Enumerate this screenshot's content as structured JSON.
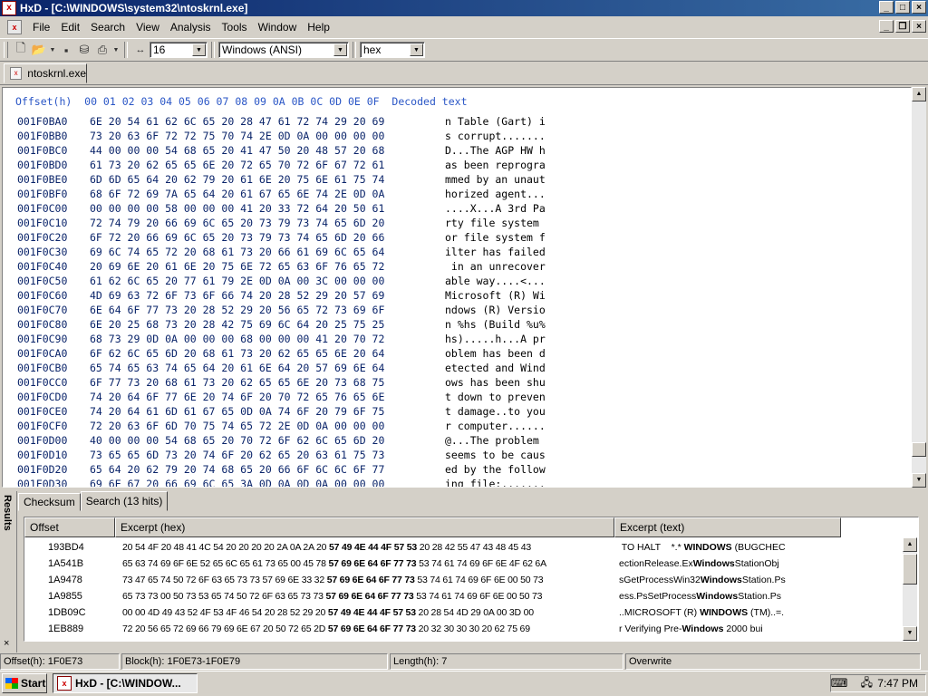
{
  "window": {
    "app_name": "HxD",
    "title": "HxD - [C:\\WINDOWS\\system32\\ntoskrnl.exe]"
  },
  "menu": [
    "File",
    "Edit",
    "Search",
    "View",
    "Analysis",
    "Tools",
    "Window",
    "Help"
  ],
  "toolbar": {
    "bytes_per_row": "16",
    "charset": "Windows (ANSI)",
    "display_mode": "hex"
  },
  "file_tab": {
    "label": "ntoskrnl.exe"
  },
  "hex_view": {
    "header": "Offset(h)  00 01 02 03 04 05 06 07 08 09 0A 0B 0C 0D 0E 0F  Decoded text",
    "rows": [
      {
        "offset": "001F0BA0",
        "bytes": "6E 20 54 61 62 6C 65 20 28 47 61 72 74 29 20 69",
        "text": "n Table (Gart) i"
      },
      {
        "offset": "001F0BB0",
        "bytes": "73 20 63 6F 72 72 75 70 74 2E 0D 0A 00 00 00 00",
        "text": "s corrupt......."
      },
      {
        "offset": "001F0BC0",
        "bytes": "44 00 00 00 54 68 65 20 41 47 50 20 48 57 20 68",
        "text": "D...The AGP HW h"
      },
      {
        "offset": "001F0BD0",
        "bytes": "61 73 20 62 65 65 6E 20 72 65 70 72 6F 67 72 61",
        "text": "as been reprogra"
      },
      {
        "offset": "001F0BE0",
        "bytes": "6D 6D 65 64 20 62 79 20 61 6E 20 75 6E 61 75 74",
        "text": "mmed by an unaut"
      },
      {
        "offset": "001F0BF0",
        "bytes": "68 6F 72 69 7A 65 64 20 61 67 65 6E 74 2E 0D 0A",
        "text": "horized agent..."
      },
      {
        "offset": "001F0C00",
        "bytes": "00 00 00 00 58 00 00 00 41 20 33 72 64 20 50 61",
        "text": "....X...A 3rd Pa"
      },
      {
        "offset": "001F0C10",
        "bytes": "72 74 79 20 66 69 6C 65 20 73 79 73 74 65 6D 20",
        "text": "rty file system "
      },
      {
        "offset": "001F0C20",
        "bytes": "6F 72 20 66 69 6C 65 20 73 79 73 74 65 6D 20 66",
        "text": "or file system f"
      },
      {
        "offset": "001F0C30",
        "bytes": "69 6C 74 65 72 20 68 61 73 20 66 61 69 6C 65 64",
        "text": "ilter has failed"
      },
      {
        "offset": "001F0C40",
        "bytes": "20 69 6E 20 61 6E 20 75 6E 72 65 63 6F 76 65 72",
        "text": " in an unrecover"
      },
      {
        "offset": "001F0C50",
        "bytes": "61 62 6C 65 20 77 61 79 2E 0D 0A 00 3C 00 00 00",
        "text": "able way....<..."
      },
      {
        "offset": "001F0C60",
        "bytes": "4D 69 63 72 6F 73 6F 66 74 20 28 52 29 20 57 69",
        "text": "Microsoft (R) Wi"
      },
      {
        "offset": "001F0C70",
        "bytes": "6E 64 6F 77 73 20 28 52 29 20 56 65 72 73 69 6F",
        "text": "ndows (R) Versio"
      },
      {
        "offset": "001F0C80",
        "bytes": "6E 20 25 68 73 20 28 42 75 69 6C 64 20 25 75 25",
        "text": "n %hs (Build %u%"
      },
      {
        "offset": "001F0C90",
        "bytes": "68 73 29 0D 0A 00 00 00 68 00 00 00 41 20 70 72",
        "text": "hs).....h...A pr"
      },
      {
        "offset": "001F0CA0",
        "bytes": "6F 62 6C 65 6D 20 68 61 73 20 62 65 65 6E 20 64",
        "text": "oblem has been d"
      },
      {
        "offset": "001F0CB0",
        "bytes": "65 74 65 63 74 65 64 20 61 6E 64 20 57 69 6E 64",
        "text": "etected and Wind"
      },
      {
        "offset": "001F0CC0",
        "bytes": "6F 77 73 20 68 61 73 20 62 65 65 6E 20 73 68 75",
        "text": "ows has been shu"
      },
      {
        "offset": "001F0CD0",
        "bytes": "74 20 64 6F 77 6E 20 74 6F 20 70 72 65 76 65 6E",
        "text": "t down to preven"
      },
      {
        "offset": "001F0CE0",
        "bytes": "74 20 64 61 6D 61 67 65 0D 0A 74 6F 20 79 6F 75",
        "text": "t damage..to you"
      },
      {
        "offset": "001F0CF0",
        "bytes": "72 20 63 6F 6D 70 75 74 65 72 2E 0D 0A 00 00 00",
        "text": "r computer......"
      },
      {
        "offset": "001F0D00",
        "bytes": "40 00 00 00 54 68 65 20 70 72 6F 62 6C 65 6D 20",
        "text": "@...The problem "
      },
      {
        "offset": "001F0D10",
        "bytes": "73 65 65 6D 73 20 74 6F 20 62 65 20 63 61 75 73",
        "text": "seems to be caus"
      },
      {
        "offset": "001F0D20",
        "bytes": "65 64 20 62 79 20 74 68 65 20 66 6F 6C 6C 6F 77",
        "text": "ed by the follow"
      },
      {
        "offset": "001F0D30",
        "bytes": "69 6E 67 20 66 69 6C 65 3A 0D 0A 0D 0A 00 00 00",
        "text": "ing file:......."
      }
    ]
  },
  "results_panel": {
    "side_label": "Results",
    "close_glyph": "×",
    "tabs": [
      "Checksum",
      "Search (13 hits)"
    ],
    "columns": [
      "Offset",
      "Excerpt (hex)",
      "Excerpt (text)"
    ],
    "rows": [
      {
        "offset": "193BD4",
        "hex_pre": "20 54 4F 20 48 41 4C 54 20 20 20 20 2A 0A 2A 20 ",
        "hex_hit": "57 49 4E 44 4F 57 53",
        "hex_post": " 20 28 42 55 47 43 48 45 43",
        "text_pre": " TO HALT    *.* ",
        "text_hit": "WINDOWS",
        "text_post": " (BUGCHEC"
      },
      {
        "offset": "1A541B",
        "hex_pre": "65 63 74 69 6F 6E 52 65 6C 65 61 73 65 00 45 78 ",
        "hex_hit": "57 69 6E 64 6F 77 73",
        "hex_post": " 53 74 61 74 69 6F 6E 4F 62 6A",
        "text_pre": "ectionRelease.Ex",
        "text_hit": "Windows",
        "text_post": "StationObj"
      },
      {
        "offset": "1A9478",
        "hex_pre": "73 47 65 74 50 72 6F 63 65 73 73 57 69 6E 33 32 ",
        "hex_hit": "57 69 6E 64 6F 77 73",
        "hex_post": " 53 74 61 74 69 6F 6E 00 50 73",
        "text_pre": "sGetProcessWin32",
        "text_hit": "Windows",
        "text_post": "Station.Ps"
      },
      {
        "offset": "1A9855",
        "hex_pre": "65 73 73 00 50 73 53 65 74 50 72 6F 63 65 73 73 ",
        "hex_hit": "57 69 6E 64 6F 77 73",
        "hex_post": " 53 74 61 74 69 6F 6E 00 50 73",
        "text_pre": "ess.PsSetProcess",
        "text_hit": "Windows",
        "text_post": "Station.Ps"
      },
      {
        "offset": "1DB09C",
        "hex_pre": "00 00 4D 49 43 52 4F 53 4F 46 54 20 28 52 29 20 ",
        "hex_hit": "57 49 4E 44 4F 57 53",
        "hex_post": " 20 28 54 4D 29 0A 00 3D 00",
        "text_pre": "..MICROSOFT (R) ",
        "text_hit": "WINDOWS",
        "text_post": " (TM)..=."
      },
      {
        "offset": "1EB889",
        "hex_pre": "72 20 56 65 72 69 66 79 69 6E 67 20 50 72 65 2D ",
        "hex_hit": "57 69 6E 64 6F 77 73",
        "hex_post": " 20 32 30 30 30 20 62 75 69",
        "text_pre": "r Verifying Pre-",
        "text_hit": "Windows",
        "text_post": " 2000 bui"
      }
    ]
  },
  "status": {
    "offset": "Offset(h): 1F0E73",
    "block": "Block(h): 1F0E73-1F0E79",
    "length": "Length(h): 7",
    "mode": "Overwrite"
  },
  "taskbar": {
    "start": "Start",
    "task": "HxD - [C:\\WINDOW...",
    "clock": "7:47 PM"
  },
  "colors": {
    "title_start": "#0a246a",
    "title_end": "#3a6ea5",
    "hex_text": "#0a246a",
    "header_text": "#2a56c6",
    "face": "#d4d0c8"
  }
}
